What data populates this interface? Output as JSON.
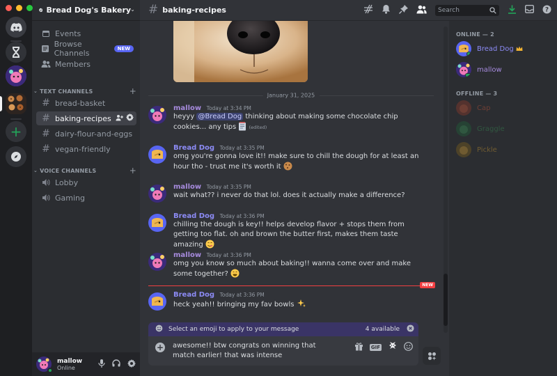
{
  "window": {
    "colors": {
      "close": "#ff5f57",
      "minimize": "#febc2e",
      "zoom": "#28c840"
    }
  },
  "server": {
    "name": "Bread Dog's Bakery"
  },
  "sidebar": {
    "items": [
      {
        "label": "Events",
        "icon": "calendar-icon"
      },
      {
        "label": "Browse Channels",
        "icon": "browse-icon",
        "badge": "NEW"
      },
      {
        "label": "Members",
        "icon": "members-icon"
      }
    ],
    "text_category": "TEXT CHANNELS",
    "text_channels": [
      "bread-basket",
      "baking-recipes",
      "dairy-flour-and-eggs",
      "vegan-friendly"
    ],
    "active_channel": "baking-recipes",
    "voice_category": "VOICE CHANNELS",
    "voice_channels": [
      "Lobby",
      "Gaming"
    ]
  },
  "user": {
    "name": "mallow",
    "status": "Online"
  },
  "topbar": {
    "channel": "baking-recipes",
    "search_placeholder": "Search"
  },
  "date_divider": "January 31, 2025",
  "messages": [
    {
      "author": "mallow",
      "time": "Today at 3:34 PM",
      "pre": "heyyy ",
      "mention": "@Bread Dog",
      "text": " thinking about making some chocolate chip cookies... any tips",
      "edited": "(edited)",
      "color": "#a78bde"
    },
    {
      "author": "Bread Dog",
      "time": "Today at 3:35 PM",
      "text": "omg you're gonna love it!! make sure to chill the dough for at least an hour tho - trust me it's worth it",
      "color": "#8c8bf5"
    },
    {
      "author": "mallow",
      "time": "Today at 3:35 PM",
      "text": "wait what?? i never do that lol. does it actually make a difference?",
      "color": "#a78bde"
    },
    {
      "author": "Bread Dog",
      "time": "Today at 3:36 PM",
      "text": "chilling the dough is key!! helps develop flavor + stops them from getting too flat. oh and brown the butter first, makes them taste amazing",
      "color": "#8c8bf5"
    },
    {
      "author": "mallow",
      "time": "Today at 3:36 PM",
      "text": "omg you know so much about baking!! wanna come over and make some together?",
      "color": "#a78bde"
    },
    {
      "author": "Bread Dog",
      "time": "Today at 3:36 PM",
      "text": "heck yeah!! bringing my fav bowls",
      "color": "#8c8bf5"
    }
  ],
  "new_marker": "NEW",
  "emoji_bar": {
    "text": "Select an emoji to apply to your message",
    "available": "4 available"
  },
  "composer": {
    "value": "awesome!! btw congrats on winning that match earlier! that was intense",
    "gif_label": "GIF"
  },
  "member_list": {
    "online_header": "ONLINE — 2",
    "online": [
      {
        "name": "Bread Dog",
        "color": "#8c8bf5"
      },
      {
        "name": "mallow",
        "color": "#a78bde"
      }
    ],
    "offline_header": "OFFLINE — 3",
    "offline": [
      {
        "name": "Cap",
        "color": "#e8603c"
      },
      {
        "name": "Graggle",
        "color": "#3ba55d"
      },
      {
        "name": "Pickle",
        "color": "#f0b232"
      }
    ]
  }
}
